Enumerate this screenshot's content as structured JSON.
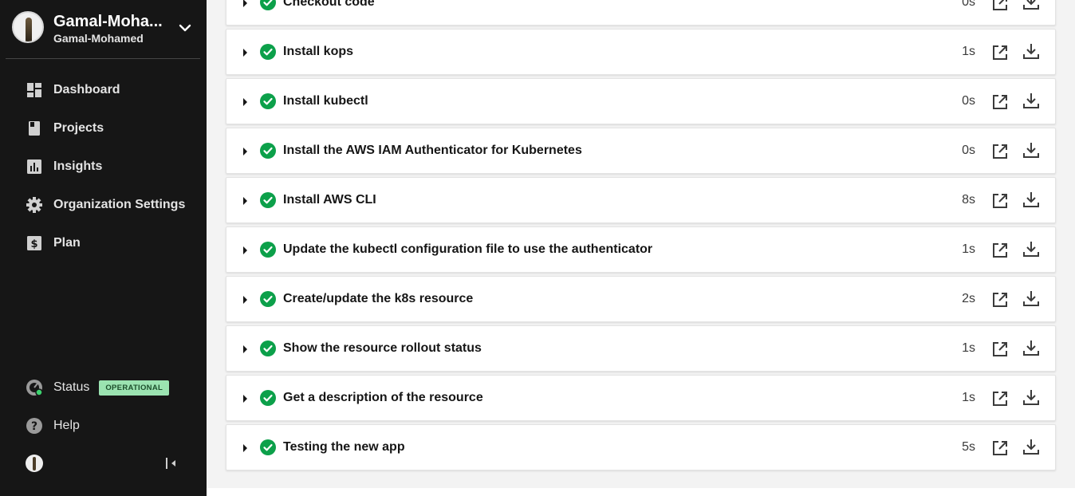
{
  "org": {
    "name": "Gamal-Moha...",
    "subname": "Gamal-Mohamed"
  },
  "nav": [
    {
      "label": "Dashboard",
      "icon": "dashboard-icon"
    },
    {
      "label": "Projects",
      "icon": "book-icon"
    },
    {
      "label": "Insights",
      "icon": "bar-chart-icon"
    },
    {
      "label": "Organization Settings",
      "icon": "gear-icon"
    },
    {
      "label": "Plan",
      "icon": "dollar-icon"
    }
  ],
  "status": {
    "label": "Status",
    "badge": "OPERATIONAL"
  },
  "help": {
    "label": "Help"
  },
  "colors": {
    "success": "#0ca04a",
    "sidebar_bg": "#161616",
    "badge_bg": "#9be3b1",
    "main_bg": "#f3f3f3"
  },
  "steps": [
    {
      "name": "Checkout code",
      "duration": "0s"
    },
    {
      "name": "Install kops",
      "duration": "1s"
    },
    {
      "name": "Install kubectl",
      "duration": "0s"
    },
    {
      "name": "Install the AWS IAM Authenticator for Kubernetes",
      "duration": "0s"
    },
    {
      "name": "Install AWS CLI",
      "duration": "8s"
    },
    {
      "name": "Update the kubectl configuration file to use the authenticator",
      "duration": "1s"
    },
    {
      "name": "Create/update the k8s resource",
      "duration": "2s"
    },
    {
      "name": "Show the resource rollout status",
      "duration": "1s"
    },
    {
      "name": "Get a description of the resource",
      "duration": "1s"
    },
    {
      "name": "Testing the new app",
      "duration": "5s"
    }
  ]
}
